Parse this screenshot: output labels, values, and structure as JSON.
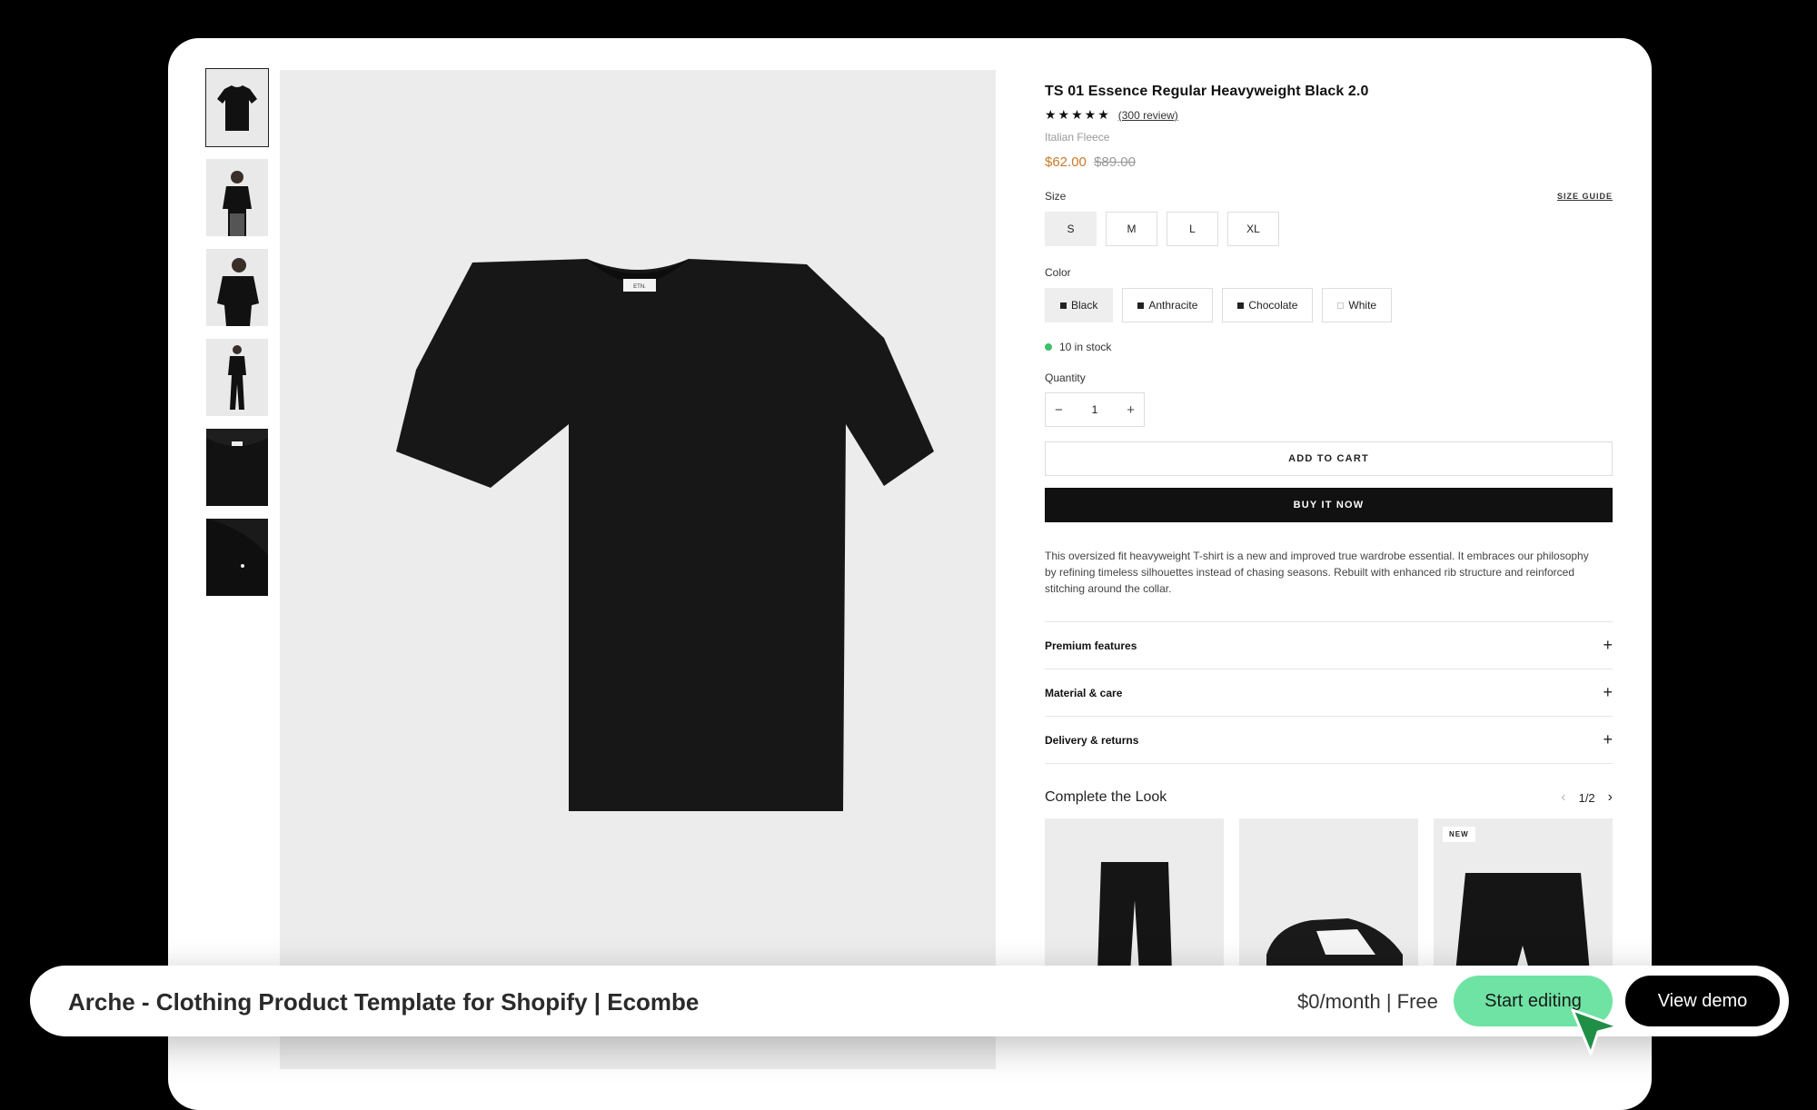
{
  "colors": {
    "accent": "#6fe3a3",
    "sale": "#c97a2a",
    "stock": "#3ec06b"
  },
  "product": {
    "title": "TS 01 Essence Regular Heavyweight Black 2.0",
    "stars": "★★★★★",
    "reviews": "(300 review)",
    "material": "Italian Fleece",
    "price": "$62.00",
    "compare_price": "$89.00",
    "size_label": "Size",
    "size_guide": "SIZE GUIDE",
    "sizes": [
      "S",
      "M",
      "L",
      "XL"
    ],
    "selected_size": "S",
    "color_label": "Color",
    "colors": [
      "Black",
      "Anthracite",
      "Chocolate",
      "White"
    ],
    "selected_color": "Black",
    "stock": "10 in stock",
    "quantity_label": "Quantity",
    "quantity": "1",
    "add_to_cart": "ADD TO CART",
    "buy_now": "BUY IT NOW",
    "description": "This oversized fit heavyweight T-shirt is a new and improved true wardrobe essential. It embraces our philosophy by refining timeless silhouettes instead of chasing seasons. Rebuilt with enhanced rib structure and reinforced stitching around the collar.",
    "accordions": [
      "Premium features",
      "Material & care",
      "Delivery & returns"
    ]
  },
  "look": {
    "title": "Complete the Look",
    "page": "1/2",
    "badge": "NEW"
  },
  "bar": {
    "title": "Arche - Clothing Product Template for Shopify | Ecombe",
    "price": "$0/month | Free",
    "start_editing": "Start editing",
    "view_demo": "View demo"
  }
}
